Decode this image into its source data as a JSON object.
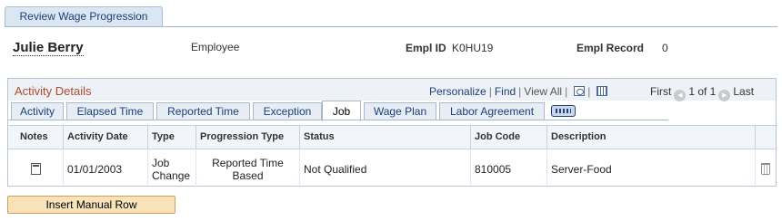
{
  "page": {
    "tab_label": "Review Wage Progression"
  },
  "employee": {
    "name": "Julie Berry",
    "role": "Employee",
    "empl_id_label": "Empl ID",
    "empl_id": "K0HU19",
    "empl_record_label": "Empl Record",
    "empl_record": "0"
  },
  "grid": {
    "title": "Activity Details",
    "personalize": "Personalize",
    "find": "Find",
    "view_all": "View All",
    "first": "First",
    "range": "1 of 1",
    "last": "Last",
    "tabs": [
      {
        "label": "Activity"
      },
      {
        "label": "Elapsed Time"
      },
      {
        "label": "Reported Time"
      },
      {
        "label": "Exception"
      },
      {
        "label": "Job"
      },
      {
        "label": "Wage Plan"
      },
      {
        "label": "Labor Agreement"
      }
    ],
    "active_tab": "Job",
    "columns": [
      "Notes",
      "Activity Date",
      "Type",
      "Progression Type",
      "Status",
      "Job Code",
      "Description"
    ],
    "rows": [
      {
        "activity_date": "01/01/2003",
        "type": "Job Change",
        "progression_type": "Reported Time Based",
        "status": "Not Qualified",
        "job_code": "810005",
        "description": "Server-Food"
      }
    ]
  },
  "actions": {
    "insert_manual_row": "Insert Manual Row"
  },
  "icons": {
    "note": "note-icon",
    "delete": "trash-icon",
    "zoom": "zoom-icon",
    "download": "grid-download-icon",
    "show_all_columns": "show-all-columns-icon",
    "prev": "arrow-left-icon",
    "next": "arrow-right-icon"
  }
}
